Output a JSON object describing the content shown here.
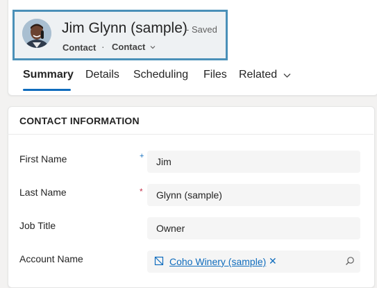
{
  "header": {
    "record_title": "Jim Glynn (sample)",
    "save_status": "- Saved",
    "entity_type": "Contact",
    "separator": "·",
    "form_name": "Contact"
  },
  "tabs": [
    {
      "label": "Summary",
      "active": true
    },
    {
      "label": "Details"
    },
    {
      "label": "Scheduling"
    },
    {
      "label": "Files"
    },
    {
      "label": "Related"
    }
  ],
  "section": {
    "title": "CONTACT INFORMATION"
  },
  "fields": {
    "first_name": {
      "label": "First Name",
      "value": "Jim",
      "required_marker": "+"
    },
    "last_name": {
      "label": "Last Name",
      "value": "Glynn (sample)",
      "required_marker": "*"
    },
    "job_title": {
      "label": "Job Title",
      "value": "Owner"
    },
    "account_name": {
      "label": "Account Name",
      "value": "Coho Winery (sample)",
      "remove": "✕"
    }
  },
  "colors": {
    "accent": "#0f6cbd",
    "required": "#c4314b",
    "focus_border": "#4a90b8"
  }
}
